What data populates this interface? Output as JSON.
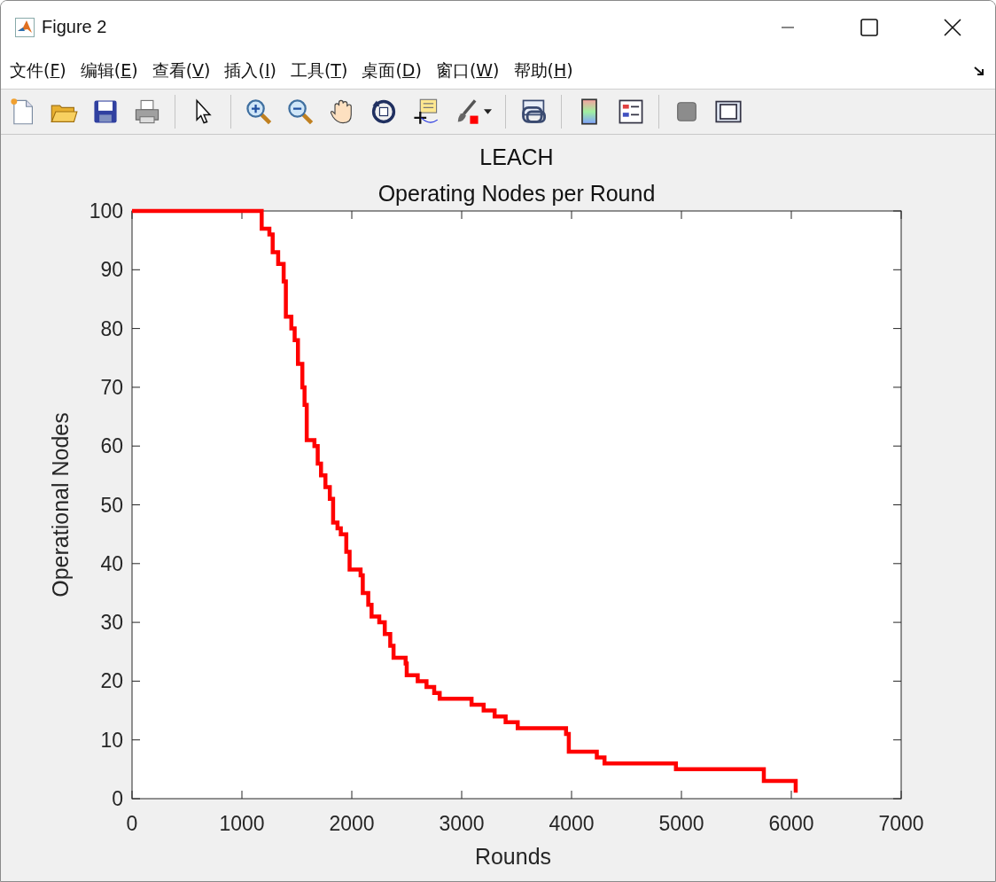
{
  "window": {
    "title": "Figure 2"
  },
  "menu": [
    {
      "label": "文件(F)"
    },
    {
      "label": "编辑(E)"
    },
    {
      "label": "查看(V)"
    },
    {
      "label": "插入(I)"
    },
    {
      "label": "工具(T)"
    },
    {
      "label": "桌面(D)"
    },
    {
      "label": "窗口(W)"
    },
    {
      "label": "帮助(H)"
    }
  ],
  "toolbar": [
    {
      "kind": "new"
    },
    {
      "kind": "open"
    },
    {
      "kind": "save"
    },
    {
      "kind": "print"
    },
    {
      "kind": "sep"
    },
    {
      "kind": "pointer"
    },
    {
      "kind": "sep"
    },
    {
      "kind": "zoomin"
    },
    {
      "kind": "zoomout"
    },
    {
      "kind": "pan"
    },
    {
      "kind": "rotate"
    },
    {
      "kind": "cursor"
    },
    {
      "kind": "brush"
    },
    {
      "kind": "sep"
    },
    {
      "kind": "link"
    },
    {
      "kind": "sep"
    },
    {
      "kind": "colorbar"
    },
    {
      "kind": "legend"
    },
    {
      "kind": "sep"
    },
    {
      "kind": "square"
    },
    {
      "kind": "panel"
    }
  ],
  "figure": {
    "title_lines": [
      "LEACH",
      "Operating Nodes per Round"
    ],
    "chart_data": {
      "type": "line",
      "xlabel": "Rounds",
      "ylabel": "Operational Nodes",
      "xlim": [
        0,
        7000
      ],
      "ylim": [
        0,
        100
      ],
      "xticks": [
        0,
        1000,
        2000,
        3000,
        4000,
        5000,
        6000,
        7000
      ],
      "yticks": [
        0,
        10,
        20,
        30,
        40,
        50,
        60,
        70,
        80,
        90,
        100
      ],
      "x": [
        0,
        1180,
        1180,
        1250,
        1250,
        1280,
        1280,
        1330,
        1330,
        1380,
        1380,
        1400,
        1400,
        1450,
        1450,
        1480,
        1480,
        1510,
        1510,
        1550,
        1550,
        1570,
        1570,
        1590,
        1590,
        1660,
        1660,
        1690,
        1690,
        1720,
        1720,
        1760,
        1760,
        1800,
        1800,
        1830,
        1830,
        1870,
        1870,
        1900,
        1900,
        1950,
        1950,
        1980,
        1980,
        2080,
        2080,
        2100,
        2100,
        2150,
        2150,
        2180,
        2180,
        2250,
        2250,
        2300,
        2300,
        2350,
        2350,
        2380,
        2380,
        2490,
        2490,
        2500,
        2500,
        2600,
        2600,
        2680,
        2680,
        2750,
        2750,
        2800,
        2800,
        3090,
        3090,
        3200,
        3200,
        3300,
        3300,
        3400,
        3400,
        3510,
        3510,
        3950,
        3950,
        3975,
        3975,
        4230,
        4230,
        4300,
        4300,
        4950,
        4950,
        5750,
        5750,
        6040,
        6040
      ],
      "series": [
        {
          "color": "#ff0000",
          "values": [
            100,
            100,
            97,
            97,
            96,
            96,
            93,
            93,
            91,
            91,
            88,
            88,
            82,
            82,
            80,
            80,
            78,
            78,
            74,
            74,
            70,
            70,
            67,
            67,
            61,
            61,
            60,
            60,
            57,
            57,
            55,
            55,
            53,
            53,
            51,
            51,
            47,
            47,
            46,
            46,
            45,
            45,
            42,
            42,
            39,
            39,
            38,
            38,
            35,
            35,
            33,
            33,
            31,
            31,
            30,
            30,
            28,
            28,
            26,
            26,
            24,
            24,
            23,
            23,
            21,
            21,
            20,
            20,
            19,
            19,
            18,
            18,
            17,
            17,
            16,
            16,
            15,
            15,
            14,
            14,
            13,
            13,
            12,
            12,
            11,
            11,
            8,
            8,
            7,
            7,
            6,
            6,
            5,
            5,
            3,
            3,
            1
          ]
        }
      ]
    }
  }
}
